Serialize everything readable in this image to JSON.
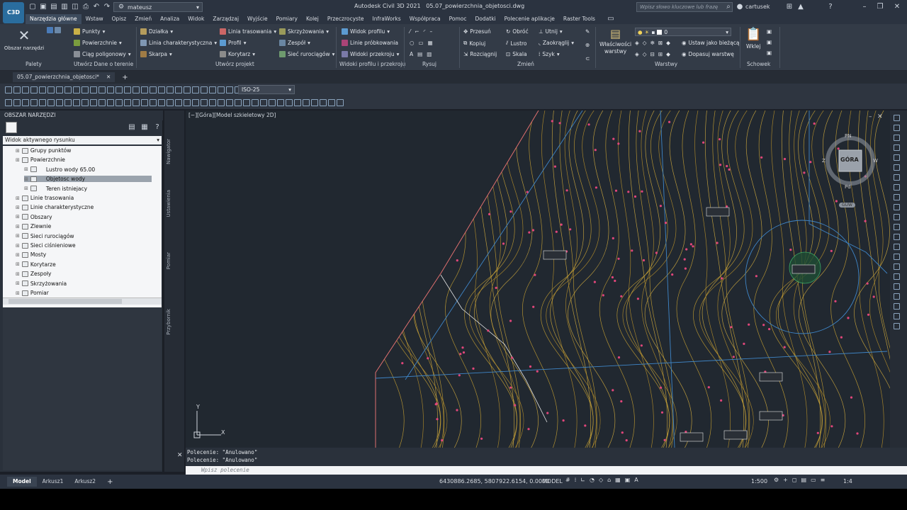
{
  "app": {
    "title": "Autodesk Civil 3D 2021",
    "filename": "05.07_powierzchnia_objetosci.dwg",
    "logo": "C3D",
    "workspace": "mateusz",
    "search_placeholder": "Wpisz słowo kluczowe lub frazę",
    "user": "cartusek"
  },
  "menus": [
    "Narzędzia główne",
    "Wstaw",
    "Opisz",
    "Zmień",
    "Analiza",
    "Widok",
    "Zarządzaj",
    "Wyjście",
    "Pomiary",
    "Kolej",
    "Przeczrocyste",
    "InfraWorks",
    "Współpraca",
    "Pomoc",
    "Dodatki",
    "Polecenie aplikacje",
    "Raster Tools"
  ],
  "ribbon": {
    "big_tool": "Obszar narzędzi",
    "points": "Punkty",
    "surfaces": "Powierzchnie",
    "polyline": "Ciąg poligonowy",
    "parcels": "Działka",
    "featureline": "Linia charakterystyczna",
    "grading": "Skarpa",
    "alignment": "Linia trasowania",
    "profile": "Profil",
    "corridor": "Korytarz",
    "intersections": "Skrzyżowania",
    "assembly": "Zespół",
    "pipe_network": "Sieć rurociągów",
    "profile_view": "Widok profilu",
    "sample_lines": "Linie próbkowania",
    "section_views": "Widoki przekroju",
    "move": "Przesuń",
    "rotate": "Obróć",
    "trim": "Utnij",
    "copy": "Kopiuj",
    "mirror": "Lustro",
    "fillet": "Zaokrąglij",
    "stretch": "Rozciągnij",
    "scale": "Skala",
    "array": "Szyk",
    "layer_props_1": "Właściwości",
    "layer_props_2": "warstwy",
    "layer_current": "0",
    "set_current": "Ustaw jako bieżącą",
    "match_layer": "Dopasuj warstwę",
    "paste": "Wklej",
    "panel_palettes": "Palety",
    "panel_create_ground": "Utwórz Dane o terenie",
    "panel_create_design": "Utwórz projekt",
    "panel_profile_section": "Widoki profilu i przekroju",
    "panel_draw": "Rysuj",
    "panel_modify": "Zmień",
    "panel_layers": "Warstwy",
    "panel_clipboard": "Schowek"
  },
  "doc_tab": "05.07_powierzchnia_objetosci*",
  "toolbar": {
    "dimstyle": "ISO-25"
  },
  "palette": {
    "header": "OBSZAR NARZĘDZI",
    "view_select": "Widok aktywnego rysunku",
    "tree": [
      {
        "label": "Grupy punktów",
        "level": 1
      },
      {
        "label": "Powierzchnie",
        "level": 1
      },
      {
        "label": "Lustro wody 65.00",
        "level": 2
      },
      {
        "label": "Objetosc wody",
        "level": 2,
        "selected": true
      },
      {
        "label": "Teren istniejacy",
        "level": 2
      },
      {
        "label": "Linie trasowania",
        "level": 1
      },
      {
        "label": "Linie charakterystyczne",
        "level": 1
      },
      {
        "label": "Obszary",
        "level": 1
      },
      {
        "label": "Zlewnie",
        "level": 1
      },
      {
        "label": "Sieci rurociągów",
        "level": 1
      },
      {
        "label": "Sieci ciśnieniowe",
        "level": 1
      },
      {
        "label": "Mosty",
        "level": 1
      },
      {
        "label": "Korytarze",
        "level": 1
      },
      {
        "label": "Zespoły",
        "level": 1
      },
      {
        "label": "Skrzyżowania",
        "level": 1
      },
      {
        "label": "Pomiar",
        "level": 1
      }
    ],
    "side_tabs": [
      "Nawigator",
      "Ustawienia",
      "Pomiar",
      "Przybornik"
    ]
  },
  "viewport": {
    "label": "[−][Góra][Model szkieletowy 2D]",
    "viewcube": {
      "top": "GÓRA",
      "n": "PN",
      "s": "Pd",
      "e": "W",
      "w": "Z",
      "wcs": "GUW"
    },
    "ucs_x": "X",
    "ucs_y": "Y"
  },
  "command": {
    "history": [
      "Polecenie: \"Anulowano\"",
      "Polecenie: \"Anulowano\""
    ],
    "placeholder": "Wpisz polecenie"
  },
  "status": {
    "tabs": [
      "Model",
      "Arkusz1",
      "Arkusz2"
    ],
    "add_tab": "+",
    "coords": "6430886.2685, 5807922.6154, 0.0000",
    "mode": "MODEL",
    "scale": "1:500",
    "anno": "1:4"
  }
}
